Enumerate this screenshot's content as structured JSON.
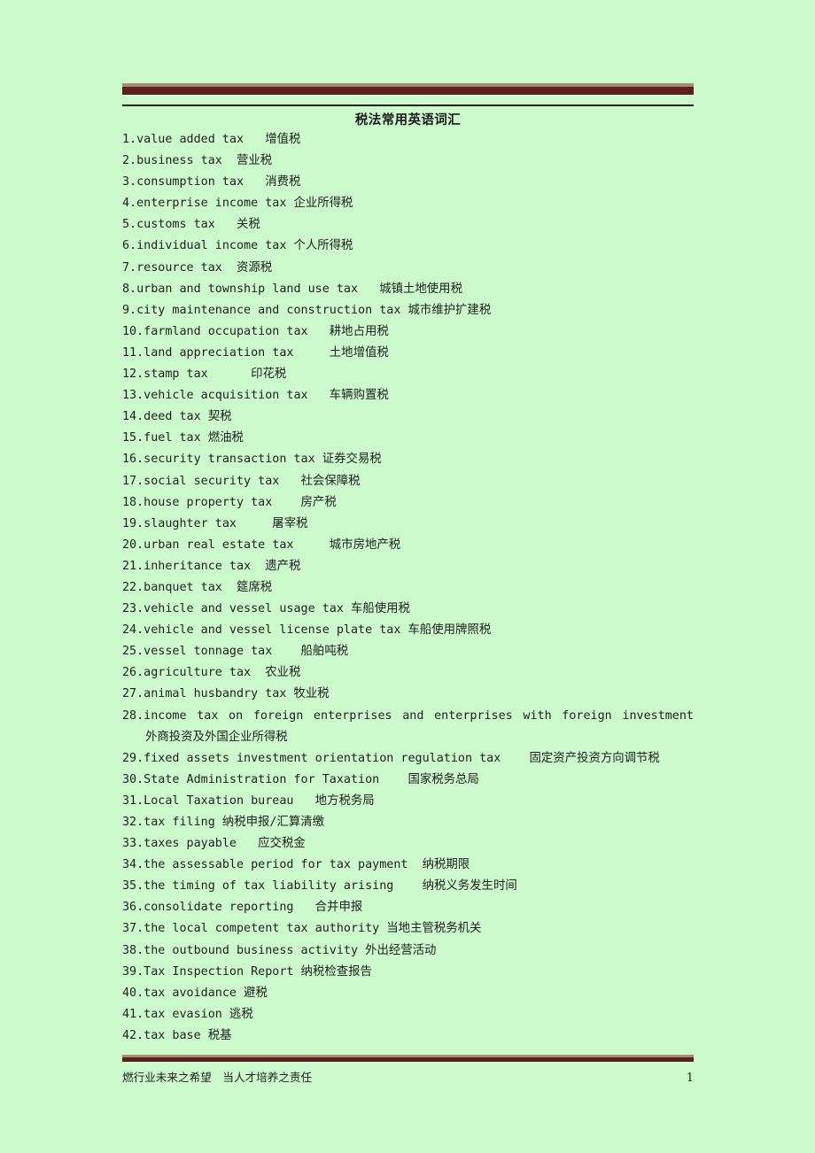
{
  "document": {
    "title": "税法常用英语词汇",
    "accent_bar_color": "#5e1f1c",
    "accent_bar_top_edge_color": "#9c9272",
    "rule_color": "#241c10",
    "background_color": "#ccfacc",
    "text_color": "#222222"
  },
  "items": [
    {
      "n": "1.",
      "text": "1.value added tax   增值税"
    },
    {
      "n": "2.",
      "text": "2.business tax  营业税"
    },
    {
      "n": "3.",
      "text": "3.consumption tax   消费税"
    },
    {
      "n": "4.",
      "text": "4.enterprise income tax 企业所得税"
    },
    {
      "n": "5.",
      "text": "5.customs tax   关税"
    },
    {
      "n": "6.",
      "text": "6.individual income tax 个人所得税"
    },
    {
      "n": "7.",
      "text": "7.resource tax  资源税"
    },
    {
      "n": "8.",
      "text": "8.urban and township land use tax   城镇土地使用税"
    },
    {
      "n": "9.",
      "text": "9.city maintenance and construction tax 城市维护扩建税"
    },
    {
      "n": "10.",
      "text": "10.farmland occupation tax   耕地占用税"
    },
    {
      "n": "11.",
      "text": "11.land appreciation tax     土地增值税"
    },
    {
      "n": "12.",
      "text": "12.stamp tax      印花税"
    },
    {
      "n": "13.",
      "text": "13.vehicle acquisition tax   车辆购置税"
    },
    {
      "n": "14.",
      "text": "14.deed tax 契税"
    },
    {
      "n": "15.",
      "text": "15.fuel tax 燃油税"
    },
    {
      "n": "16.",
      "text": "16.security transaction tax 证券交易税"
    },
    {
      "n": "17.",
      "text": "17.social security tax   社会保障税"
    },
    {
      "n": "18.",
      "text": "18.house property tax    房产税"
    },
    {
      "n": "19.",
      "text": "19.slaughter tax     屠宰税"
    },
    {
      "n": "20.",
      "text": "20.urban real estate tax     城市房地产税"
    },
    {
      "n": "21.",
      "text": "21.inheritance tax  遗产税"
    },
    {
      "n": "22.",
      "text": "22.banquet tax  筵席税"
    },
    {
      "n": "23.",
      "text": "23.vehicle and vessel usage tax 车船使用税"
    },
    {
      "n": "24.",
      "text": "24.vehicle and vessel license plate tax 车船使用牌照税"
    },
    {
      "n": "25.",
      "text": "25.vessel tonnage tax    船舶吨税"
    },
    {
      "n": "26.",
      "text": "26.agriculture tax  农业税"
    },
    {
      "n": "27.",
      "text": "27.animal husbandry tax 牧业税"
    },
    {
      "n": "29.",
      "text": "29.fixed assets investment orientation regulation tax    固定资产投资方向调节税"
    },
    {
      "n": "30.",
      "text": "30.State Administration for Taxation    国家税务总局"
    },
    {
      "n": "31.",
      "text": "31.Local Taxation bureau   地方税务局"
    },
    {
      "n": "32.",
      "text": "32.tax filing 纳税申报/汇算清缴"
    },
    {
      "n": "33.",
      "text": "33.taxes payable   应交税金"
    },
    {
      "n": "34.",
      "text": "34.the assessable period for tax payment  纳税期限"
    },
    {
      "n": "35.",
      "text": "35.the timing of tax liability arising    纳税义务发生时间"
    },
    {
      "n": "36.",
      "text": "36.consolidate reporting   合并申报"
    },
    {
      "n": "37.",
      "text": "37.the local competent tax authority 当地主管税务机关"
    },
    {
      "n": "38.",
      "text": "38.the outbound business activity 外出经营活动"
    },
    {
      "n": "39.",
      "text": "39.Tax Inspection Report 纳税检查报告"
    },
    {
      "n": "40.",
      "text": "40.tax avoidance 避税"
    },
    {
      "n": "41.",
      "text": "41.tax evasion 逃税"
    },
    {
      "n": "42.",
      "text": "42.tax base 税基"
    }
  ],
  "item_28": {
    "number": "28.",
    "english": "28.income tax on foreign enterprises and enterprises with foreign investment",
    "chinese": "外商投资及外国企业所得税"
  },
  "footer": {
    "text": "燃行业未来之希望　当人才培养之责任",
    "page_number": "1"
  }
}
